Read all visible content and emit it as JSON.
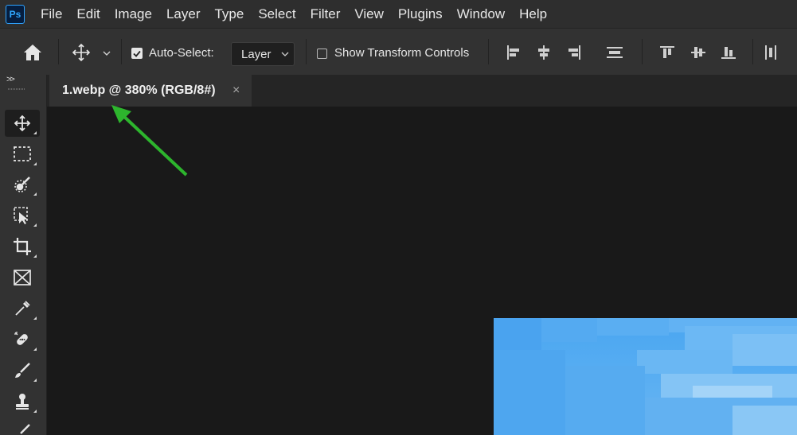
{
  "app": {
    "logo_text": "Ps"
  },
  "menu": [
    "File",
    "Edit",
    "Image",
    "Layer",
    "Type",
    "Select",
    "Filter",
    "View",
    "Plugins",
    "Window",
    "Help"
  ],
  "options_bar": {
    "auto_select_label": "Auto-Select:",
    "auto_select_checked": true,
    "layer_select_value": "Layer",
    "show_transform_label": "Show Transform Controls",
    "show_transform_checked": false
  },
  "document": {
    "tab_title": "1.webp @ 380% (RGB/8#)",
    "close_glyph": "×"
  },
  "colors": {
    "annotation_arrow": "#2db52d",
    "sky_blue": "#4aa6f0"
  }
}
